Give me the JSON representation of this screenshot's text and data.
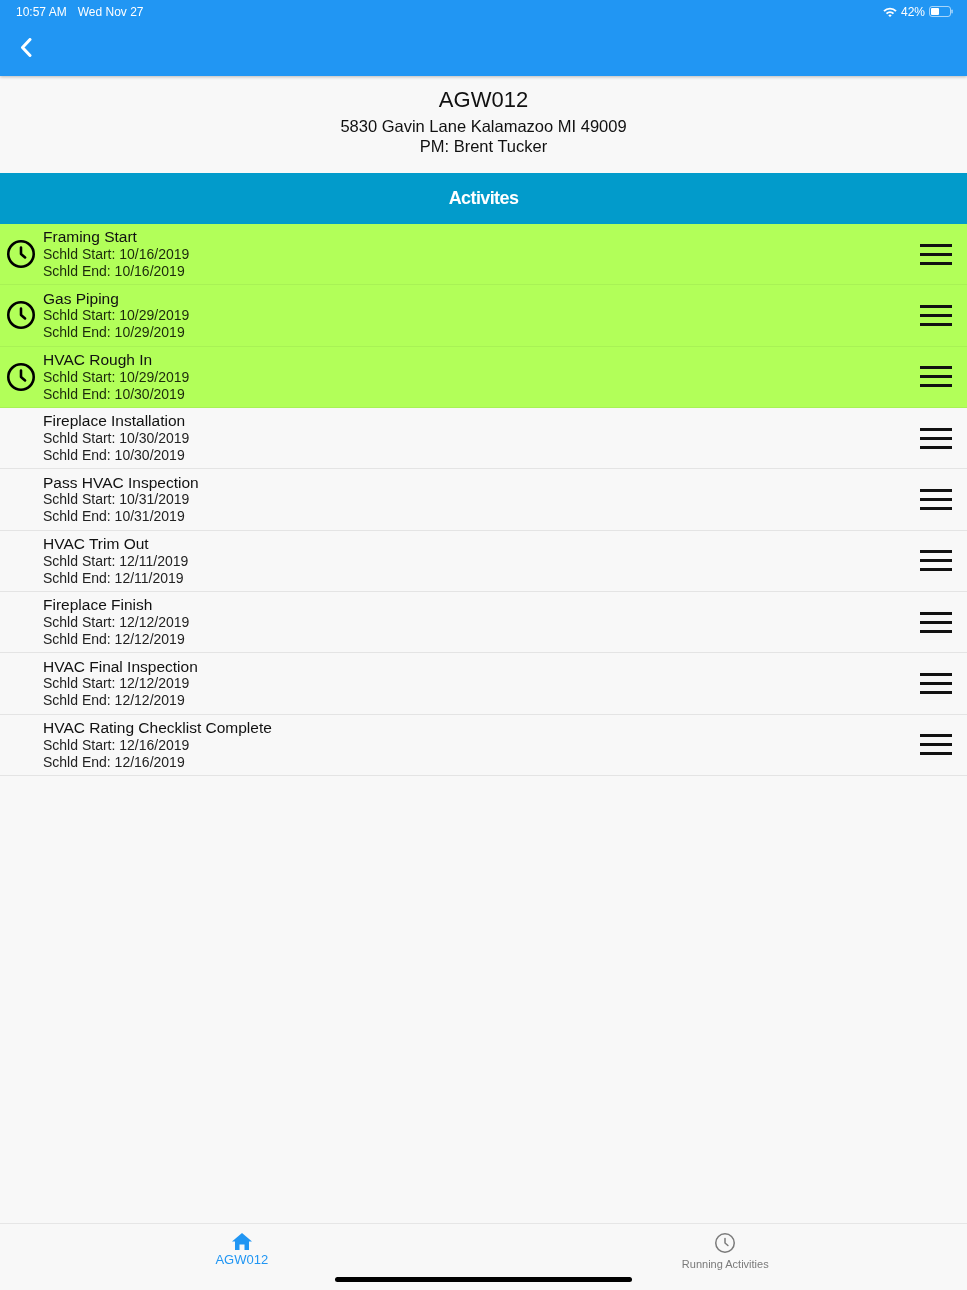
{
  "status_bar": {
    "time": "10:57 AM",
    "date": "Wed Nov 27",
    "battery": "42%"
  },
  "job": {
    "code": "AGW012",
    "address": "5830 Gavin Lane Kalamazoo MI 49009",
    "manager": "PM: Brent Tucker"
  },
  "section": {
    "title": "Activites"
  },
  "activities": [
    {
      "name": "Framing Start",
      "start": "Schld Start: 10/16/2019",
      "end": "Schld End: 10/16/2019",
      "running": true
    },
    {
      "name": "Gas Piping",
      "start": "Schld Start: 10/29/2019",
      "end": "Schld End: 10/29/2019",
      "running": true
    },
    {
      "name": "HVAC Rough In",
      "start": "Schld Start: 10/29/2019",
      "end": "Schld End: 10/30/2019",
      "running": true
    },
    {
      "name": "Fireplace Installation",
      "start": "Schld Start: 10/30/2019",
      "end": "Schld End: 10/30/2019",
      "running": false
    },
    {
      "name": "Pass HVAC Inspection",
      "start": "Schld Start: 10/31/2019",
      "end": "Schld End: 10/31/2019",
      "running": false
    },
    {
      "name": "HVAC Trim Out",
      "start": "Schld Start: 12/11/2019",
      "end": "Schld End: 12/11/2019",
      "running": false
    },
    {
      "name": "Fireplace Finish",
      "start": "Schld Start: 12/12/2019",
      "end": "Schld End: 12/12/2019",
      "running": false
    },
    {
      "name": "HVAC Final Inspection",
      "start": "Schld Start: 12/12/2019",
      "end": "Schld End: 12/12/2019",
      "running": false
    },
    {
      "name": "HVAC Rating Checklist Complete",
      "start": "Schld Start: 12/16/2019",
      "end": "Schld End: 12/16/2019",
      "running": false
    }
  ],
  "tab_bar": {
    "tabs": [
      {
        "label": "AGW012",
        "kind": "home",
        "selected": true
      },
      {
        "label": "Running Activities",
        "kind": "clock",
        "selected": false
      }
    ]
  }
}
